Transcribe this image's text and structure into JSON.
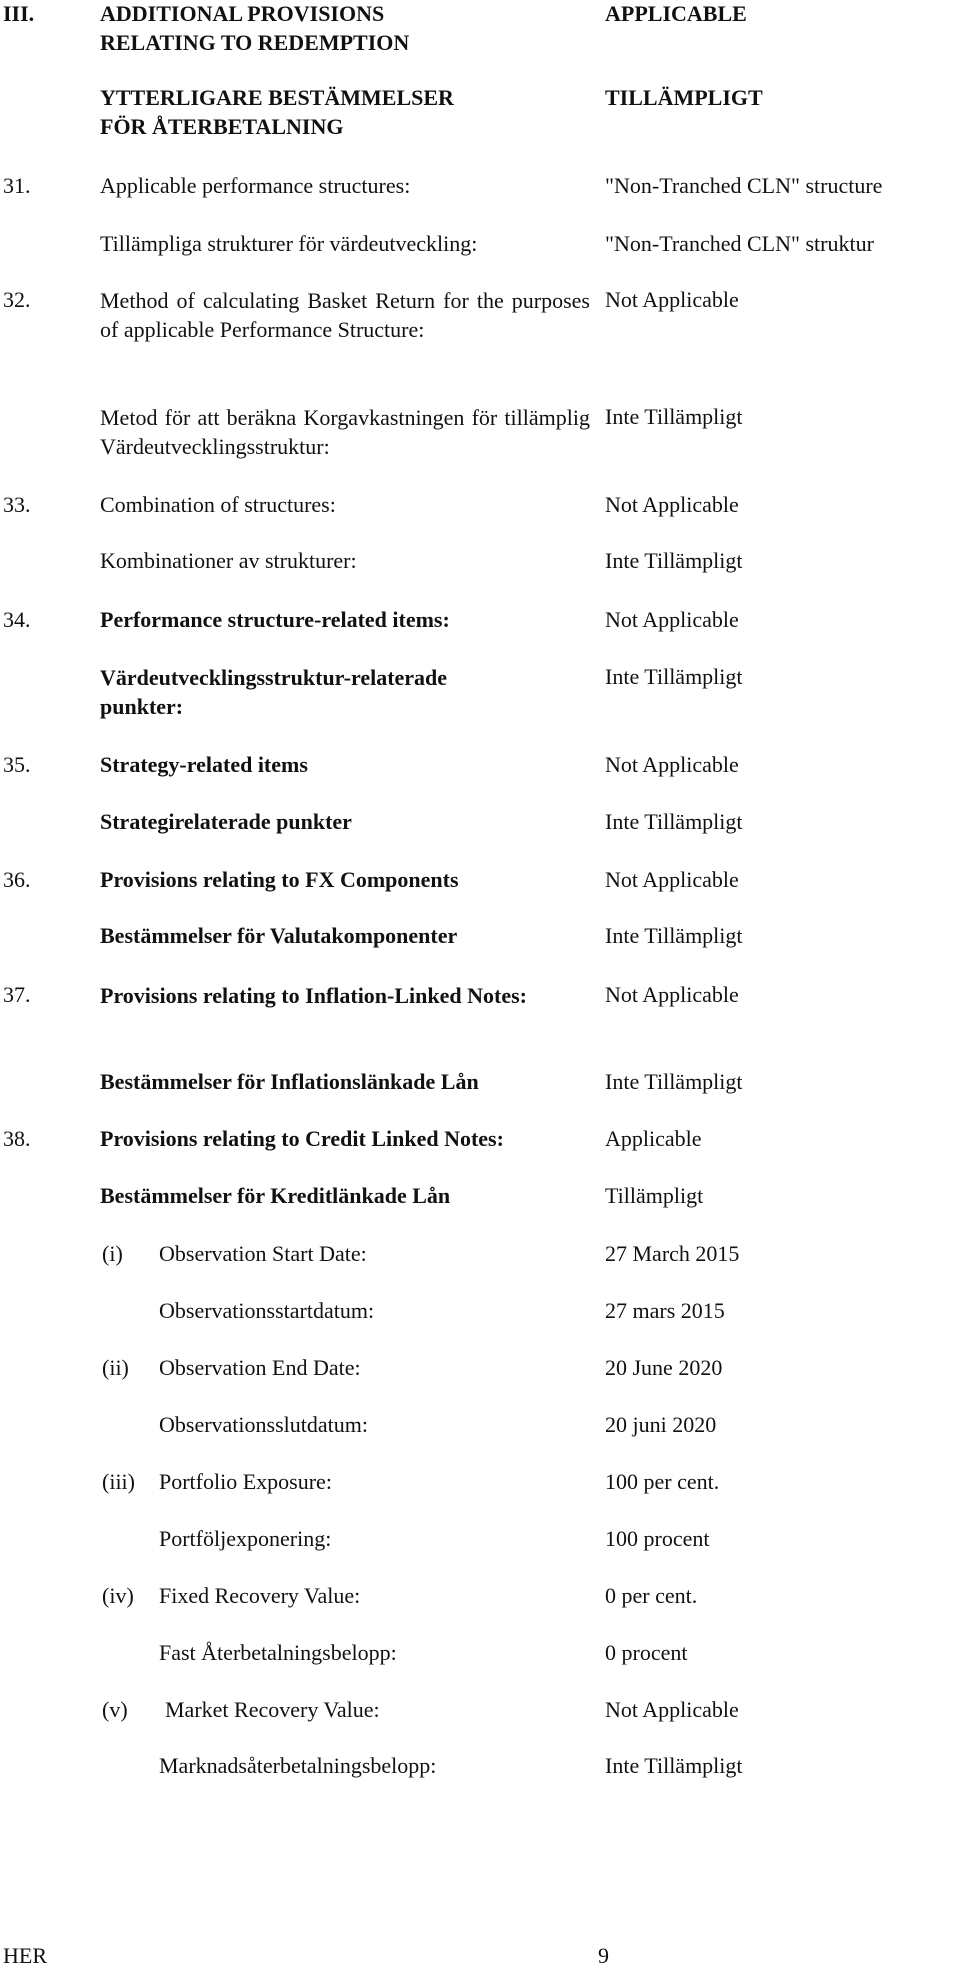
{
  "section": {
    "number": "III.",
    "title_en_line1": "ADDITIONAL PROVISIONS",
    "title_en_line2": "RELATING TO REDEMPTION",
    "value_en": "APPLICABLE",
    "title_sv_line1": "YTTERLIGARE BESTÄMMELSER",
    "title_sv_line2": "FÖR ÅTERBETALNING",
    "value_sv": "TILLÄMPLIGT"
  },
  "items": [
    {
      "num": "31.",
      "label_en": "Applicable performance structures:",
      "value_en": "\"Non-Tranched CLN\" structure",
      "label_sv": "Tillämpliga strukturer för värdeutveckling:",
      "value_sv": "\"Non-Tranched CLN\" struktur"
    },
    {
      "num": "32.",
      "label_en": "Method of calculating Basket Return for the purposes of applicable Performance Structure:",
      "value_en": "Not Applicable",
      "label_sv": "Metod för att beräkna Korgavkastningen för tillämplig Värdeutvecklingsstruktur:",
      "value_sv": "Inte Tillämpligt"
    },
    {
      "num": "33.",
      "label_en": "Combination of structures:",
      "value_en": "Not Applicable",
      "label_sv": "Kombinationer av strukturer:",
      "value_sv": "Inte Tillämpligt"
    },
    {
      "num": "34.",
      "label_en": "Performance structure-related items:",
      "value_en": "Not Applicable",
      "label_sv": "Värdeutvecklingsstruktur-relaterade punkter:",
      "value_sv": "Inte Tillämpligt"
    },
    {
      "num": "35.",
      "label_en": "Strategy-related items",
      "value_en": "Not Applicable",
      "label_sv": "Strategirelaterade punkter",
      "value_sv": "Inte Tillämpligt"
    },
    {
      "num": "36.",
      "label_en": "Provisions relating to FX Components",
      "value_en": "Not Applicable",
      "label_sv": "Bestämmelser för Valutakomponenter",
      "value_sv": "Inte Tillämpligt"
    },
    {
      "num": "37.",
      "label_en": "Provisions relating to Inflation-Linked Notes:",
      "value_en": "Not Applicable",
      "label_sv": "Bestämmelser för Inflationslänkade Lån",
      "value_sv": "Inte Tillämpligt"
    },
    {
      "num": "38.",
      "label_en": "Provisions relating to Credit Linked Notes:",
      "value_en": "Applicable",
      "label_sv": "Bestämmelser för Kreditlänkade Lån",
      "value_sv": "Tillämpligt"
    }
  ],
  "subitems": [
    {
      "num": "(i)",
      "label_en": "Observation Start Date:",
      "value_en": "27 March 2015",
      "label_sv": "Observationsstartdatum:",
      "value_sv": "27 mars 2015"
    },
    {
      "num": "(ii)",
      "label_en": "Observation End Date:",
      "value_en": "20 June 2020",
      "label_sv": "Observationsslutdatum:",
      "value_sv": "20 juni 2020"
    },
    {
      "num": "(iii)",
      "label_en": "Portfolio Exposure:",
      "value_en": "100 per cent.",
      "label_sv": "Portföljexponering:",
      "value_sv": "100 procent"
    },
    {
      "num": "(iv)",
      "label_en": "Fixed Recovery Value:",
      "value_en": "0 per cent.",
      "label_sv": "Fast Återbetalningsbelopp:",
      "value_sv": "0 procent"
    },
    {
      "num": "(v)",
      "label_en": "Market Recovery Value:",
      "value_en": "Not Applicable",
      "label_sv": "Marknadsåterbetalningsbelopp:",
      "value_sv": "Inte Tillämpligt"
    }
  ],
  "footer": {
    "left": "HER",
    "page_number": "9"
  }
}
